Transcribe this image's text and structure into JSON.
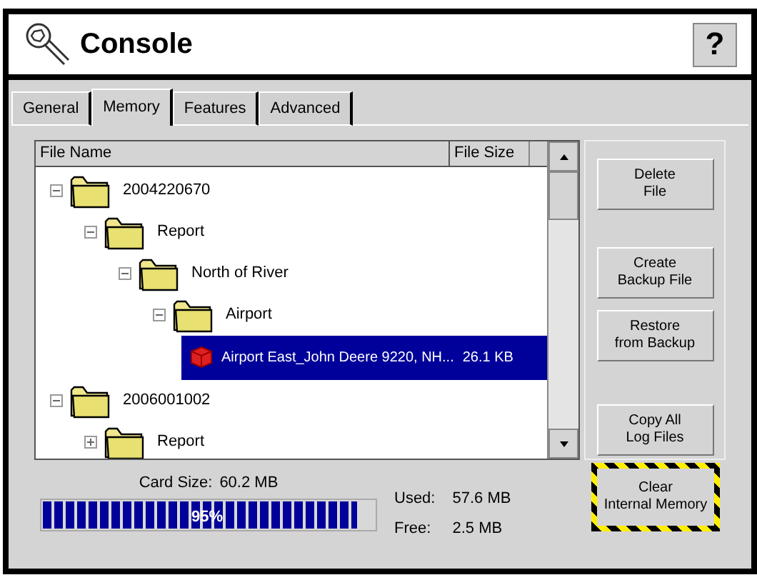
{
  "window": {
    "title": "Console",
    "help_button": "?"
  },
  "tabs": [
    {
      "label": "General",
      "selected": false
    },
    {
      "label": "Memory",
      "selected": true
    },
    {
      "label": "Features",
      "selected": false
    },
    {
      "label": "Advanced",
      "selected": false
    }
  ],
  "file_list": {
    "columns": [
      "File Name",
      "File Size"
    ],
    "items": [
      {
        "kind": "folder",
        "name": "2004220670",
        "expanded": true,
        "children": [
          {
            "kind": "folder",
            "name": "Report",
            "expanded": true,
            "children": [
              {
                "kind": "folder",
                "name": "North of River",
                "expanded": true,
                "children": [
                  {
                    "kind": "folder",
                    "name": "Airport",
                    "expanded": true,
                    "children": [
                      {
                        "kind": "file",
                        "name": "Airport East_John Deere 9220, NH...",
                        "size": "26.1 KB",
                        "selected": true
                      }
                    ]
                  }
                ]
              }
            ]
          }
        ]
      },
      {
        "kind": "folder",
        "name": "2006001002",
        "expanded": true,
        "children": [
          {
            "kind": "folder",
            "name": "Report",
            "expanded": false
          }
        ]
      }
    ]
  },
  "actions": [
    "Delete\nFile",
    "Create\nBackup File",
    "Restore\nfrom Backup",
    "Copy All\nLog Files"
  ],
  "memory": {
    "card_size_label": "Card Size:",
    "card_size": "60.2 MB",
    "level": 0.95,
    "percent": "95%",
    "used_label": "Used:",
    "used": "57.6 MB",
    "free_label": "Free:",
    "free": "2.5 MB"
  },
  "clear_button": "Clear\nInternal Memory"
}
